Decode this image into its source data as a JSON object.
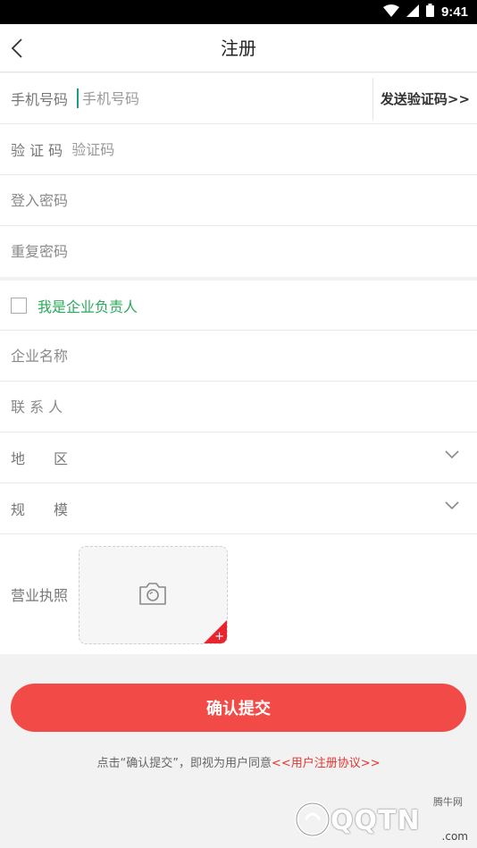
{
  "status_bar": {
    "time": "9:41"
  },
  "header": {
    "title": "注册"
  },
  "form": {
    "phone_label": "手机号码",
    "phone_placeholder": "手机号码",
    "send_code": "发送验证码>>",
    "code_label": "验 证 码",
    "code_placeholder": "验证码",
    "login_password_placeholder": "登入密码",
    "repeat_password_placeholder": "重复密码",
    "company_owner": "我是企业负责人",
    "company_name_placeholder": "企业名称",
    "contact_placeholder": "联 系 人",
    "region_label": "地　　区",
    "scale_label": "规　　模",
    "license_label": "营业执照",
    "submit": "确认提交",
    "agreement_prefix": "点击“确认提交”，即视为用户同意",
    "agreement_link": "<<用户注册协议>>"
  },
  "watermark": {
    "brand": "QQTN",
    "small": "腾牛网",
    "domain": ".com"
  },
  "colors": {
    "accent": "#f24a46",
    "check_green": "#2aaa5a",
    "link_red": "#e8342e"
  }
}
